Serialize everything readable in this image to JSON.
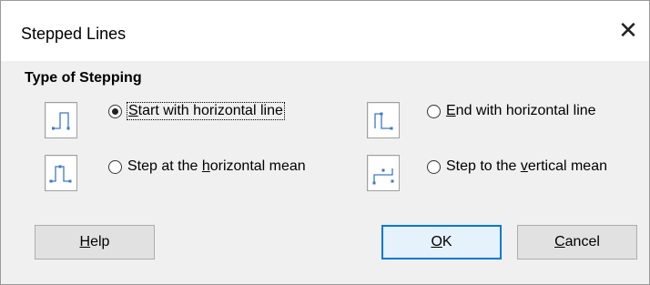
{
  "dialog": {
    "title": "Stepped Lines",
    "close_glyph": "✕"
  },
  "section": {
    "title": "Type of Stepping"
  },
  "options": [
    {
      "pre": "",
      "key": "S",
      "post": "tart with horizontal line",
      "checked": true,
      "icon": "start-horizontal-step-icon"
    },
    {
      "pre": "",
      "key": "E",
      "post": "nd with horizontal line",
      "checked": false,
      "icon": "end-horizontal-step-icon"
    },
    {
      "pre": "Step at the ",
      "key": "h",
      "post": "orizontal mean",
      "checked": false,
      "icon": "horizontal-mean-step-icon"
    },
    {
      "pre": "Step to the ",
      "key": "v",
      "post": "ertical mean",
      "checked": false,
      "icon": "vertical-mean-step-icon"
    }
  ],
  "buttons": {
    "help": {
      "key": "H",
      "rest": "elp"
    },
    "ok": {
      "key": "O",
      "rest": "K"
    },
    "cancel": {
      "key": "C",
      "rest": "ancel"
    }
  },
  "colors": {
    "icon_line": "#3c78c8",
    "default_button_border": "#0078d7"
  }
}
